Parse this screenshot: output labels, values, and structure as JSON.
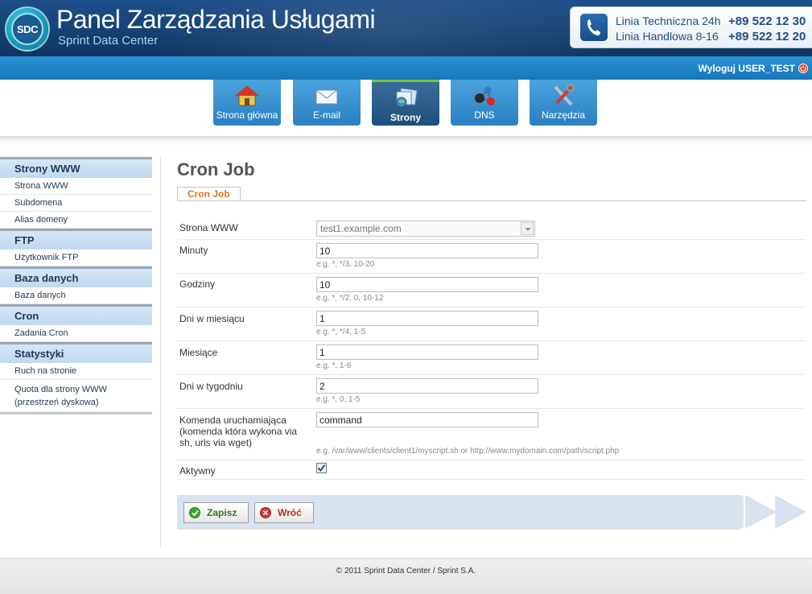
{
  "header": {
    "logo_text": "SDC",
    "title": "Panel Zarządzania Usługami",
    "subtitle": "Sprint Data Center",
    "contact": [
      {
        "label": "Linia Techniczna 24h",
        "number": "+89 522 12 30"
      },
      {
        "label": "Linia Handlowa 8-16",
        "number": "+89 522 12 20"
      }
    ]
  },
  "userbar": {
    "logout_label": "Wyloguj USER_TEST"
  },
  "nav": {
    "tabs": [
      {
        "label": "Strona główna",
        "icon": "home-icon"
      },
      {
        "label": "E-mail",
        "icon": "envelope-icon"
      },
      {
        "label": "Strony",
        "icon": "sites-icon",
        "active": true
      },
      {
        "label": "DNS",
        "icon": "dns-network-icon"
      },
      {
        "label": "Narzędzia",
        "icon": "tools-icon"
      }
    ]
  },
  "sidebar": {
    "sections": [
      {
        "title": "Strony WWW",
        "items": [
          "Strona WWW",
          "Subdomena",
          "Alias domeny"
        ]
      },
      {
        "title": "FTP",
        "items": [
          "Użytkownik FTP"
        ]
      },
      {
        "title": "Baza danych",
        "items": [
          "Baza danych"
        ]
      },
      {
        "title": "Cron",
        "items": [
          "Zadania Cron"
        ]
      },
      {
        "title": "Statystyki",
        "items": [
          "Ruch na stronie",
          "Quota dla strony WWW",
          "(przestrzeń dyskowa)"
        ]
      }
    ]
  },
  "main": {
    "page_title": "Cron Job",
    "tab_label": "Cron Job",
    "form": {
      "website": {
        "label": "Strona WWW",
        "value": "test1.example.com"
      },
      "minutes": {
        "label": "Minuty",
        "value": "10",
        "hint": "e.g. *, */3, 10-20"
      },
      "hours": {
        "label": "Godziny",
        "value": "10",
        "hint": "e.g. *, */2, 0, 10-12"
      },
      "days_month": {
        "label": "Dni w miesiącu",
        "value": "1",
        "hint": "e.g. *, */4, 1-5"
      },
      "months": {
        "label": "Miesiące",
        "value": "1",
        "hint": "e.g. *, 1-6"
      },
      "days_week": {
        "label": "Dni w tygodniu",
        "value": "2",
        "hint": "e.g. *, 0, 1-5"
      },
      "command": {
        "label_1": "Komenda uruchamiająca",
        "label_2": "(komenda która wykona via",
        "label_3": "sh, urls via wget)",
        "value": "command",
        "hint": "e.g. /var/www/clients/client1/myscript.sh or http://www.mydomain.com/path/script.php"
      },
      "active": {
        "label": "Aktywny",
        "checked": true
      }
    },
    "buttons": {
      "save": "Zapisz",
      "back": "Wróć"
    }
  },
  "footer": {
    "text": "© 2011 Sprint Data Center / Sprint S.A."
  },
  "colors": {
    "header_blue": "#164276",
    "userbar_blue": "#1877bb",
    "tab_orange": "#e57018",
    "active_nav": "#1e4f7c"
  }
}
